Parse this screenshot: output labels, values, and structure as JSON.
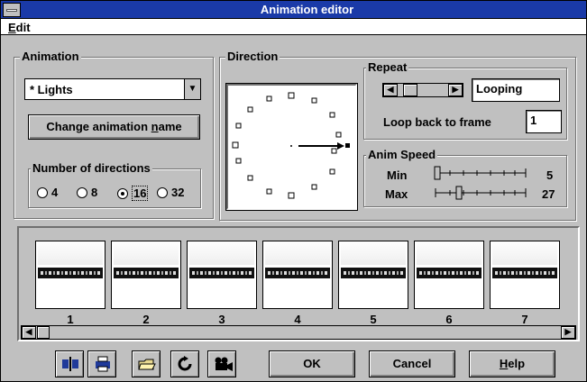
{
  "window": {
    "title": "Animation editor"
  },
  "menu": {
    "edit_label": "Edit",
    "edit_mnemonic": "E",
    "edit_rest": "dit"
  },
  "animation": {
    "legend": "Animation",
    "selected": "* Lights",
    "change_name_label_pre": "Change animation ",
    "change_name_label_u": "n",
    "change_name_label_post": "ame",
    "directions": {
      "legend": "Number of directions",
      "options": [
        "4",
        "8",
        "16",
        "32"
      ],
      "selected": "16"
    }
  },
  "direction": {
    "legend": "Direction",
    "pointer_icon": "arrow-right-icon"
  },
  "repeat": {
    "legend": "Repeat",
    "mode": "Looping",
    "loop_label": "Loop back to frame",
    "loop_value": "1"
  },
  "speed": {
    "legend": "Anim Speed",
    "min_label": "Min",
    "min_value": "5",
    "max_label": "Max",
    "max_value": "27"
  },
  "frames": {
    "items": [
      {
        "label": "1"
      },
      {
        "label": "2"
      },
      {
        "label": "3"
      },
      {
        "label": "4"
      },
      {
        "label": "5"
      },
      {
        "label": "6"
      },
      {
        "label": "7"
      }
    ]
  },
  "toolbar": {
    "icons": [
      "mirror-icon",
      "print-icon",
      "open-folder-icon",
      "rotate-icon",
      "camera-icon"
    ]
  },
  "buttons": {
    "ok": "OK",
    "cancel": "Cancel",
    "help_u": "H",
    "help_rest": "elp"
  },
  "colors": {
    "titlebar": "#1a3aa8",
    "face": "#c0c0c0"
  }
}
